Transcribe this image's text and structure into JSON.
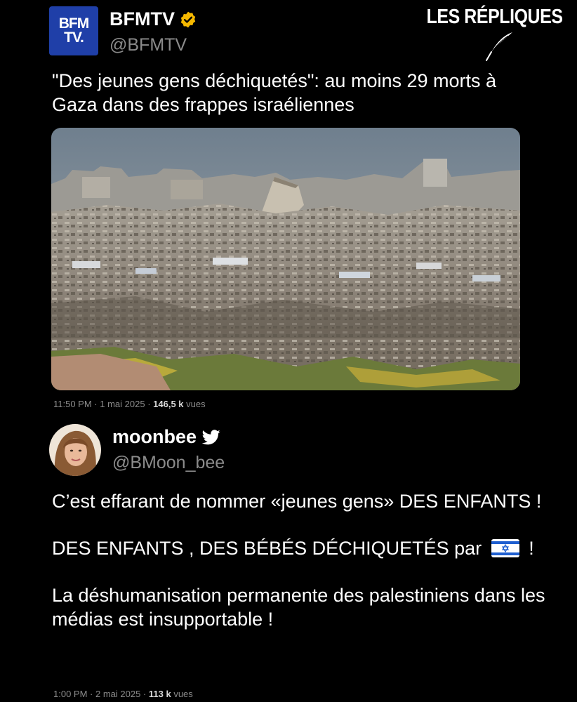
{
  "brand": {
    "text": "LES RÉPLIQUES",
    "quill_icon": "quill-icon"
  },
  "tweet1": {
    "logo_line1": "BFM",
    "logo_line2": "TV.",
    "display_name": "BFMTV",
    "handle": "@BFMTV",
    "text": "\"Des jeunes gens déchiquetés\": au moins 29 morts à Gaza dans des frappes israéliennes",
    "time": "11:50 PM",
    "date": "1 mai 2025",
    "views_count": "146,5 k",
    "views_label": "vues",
    "badge_color": "#f5b800"
  },
  "tweet2": {
    "display_name": "moonbee",
    "handle": "@BMoon_bee",
    "line1": "C’est effarant de nommer «jeunes gens» DES ENFANTS !",
    "line2_before_flag": "DES ENFANTS , DES BÉBÉS DÉCHIQUETÉS par",
    "line2_after_flag": "!",
    "flag_icon": "israel-flag-icon",
    "line3": "La déshumanisation permanente des palestiniens dans les médias est insupportable !",
    "time": "1:00 PM",
    "date": "2 mai 2025",
    "views_count": "113 k",
    "views_label": "vues"
  },
  "separator": " · "
}
